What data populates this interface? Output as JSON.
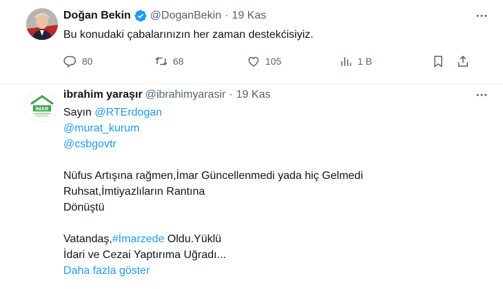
{
  "tweet1": {
    "author_name": "Doğan Bekin",
    "handle": "@DoganBekin",
    "separator": "·",
    "time": "19 Kas",
    "text": "Bu konudaki çabalarınızın her zaman destekćisiyiz.",
    "actions": {
      "reply_count": "80",
      "retweet_count": "68",
      "like_count": "105",
      "views_count": "1 B"
    }
  },
  "tweet2": {
    "author_name": "ibrahim yaraşır",
    "handle": "@ibrahimyarasir",
    "separator": "·",
    "time": "19 Kas",
    "avatar_logo_text": "İMAR",
    "lines": {
      "l1_prefix": "Sayın ",
      "l1_mention": "@RTErdogan",
      "l2_mention": "@murat_kurum",
      "l3_mention": "@csbgovtr",
      "l5": "Nüfus Artışına rağmen,İmar Güncellenmedi yada hiç Gelmedi",
      "l6": "Ruhsat,İmtiyazlıların Rantına",
      "l7": "Dönüştü",
      "l9_prefix": "Vatandaş,",
      "l9_hashtag": "#İmarzede",
      "l9_suffix": " Oldu.Yüklü",
      "l10": "İdari ve Cezai Yaptırıma Uğradı..."
    },
    "show_more": "Daha fazla göster"
  },
  "colors": {
    "accent": "#1d9bf0",
    "text_primary": "#0f1419",
    "text_secondary": "#536471",
    "divider": "#eff3f4",
    "logo_green": "#3aa64a"
  },
  "icons": [
    "verified-badge-icon",
    "more-options-icon",
    "reply-icon",
    "retweet-icon",
    "like-icon",
    "views-icon",
    "bookmark-icon",
    "share-icon"
  ]
}
